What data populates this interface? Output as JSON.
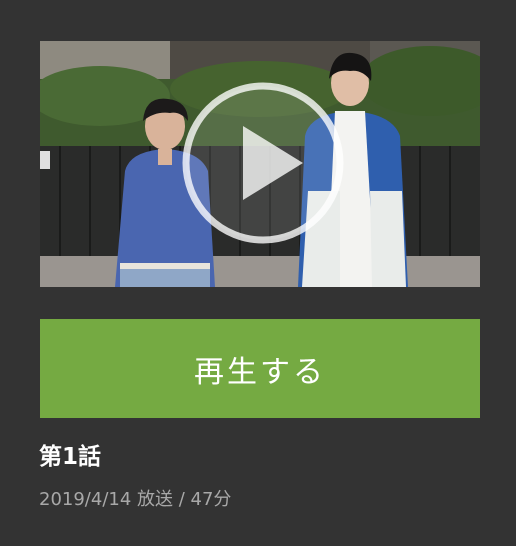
{
  "episode": {
    "thumbnail_icon": "play-circle-icon",
    "play_label": "再生する",
    "title": "第1話",
    "meta": "2019/4/14 放送 / 47分"
  },
  "colors": {
    "background": "#333333",
    "play_button": "#75aa42",
    "title_text": "#ffffff",
    "meta_text": "#a8a8a8"
  }
}
